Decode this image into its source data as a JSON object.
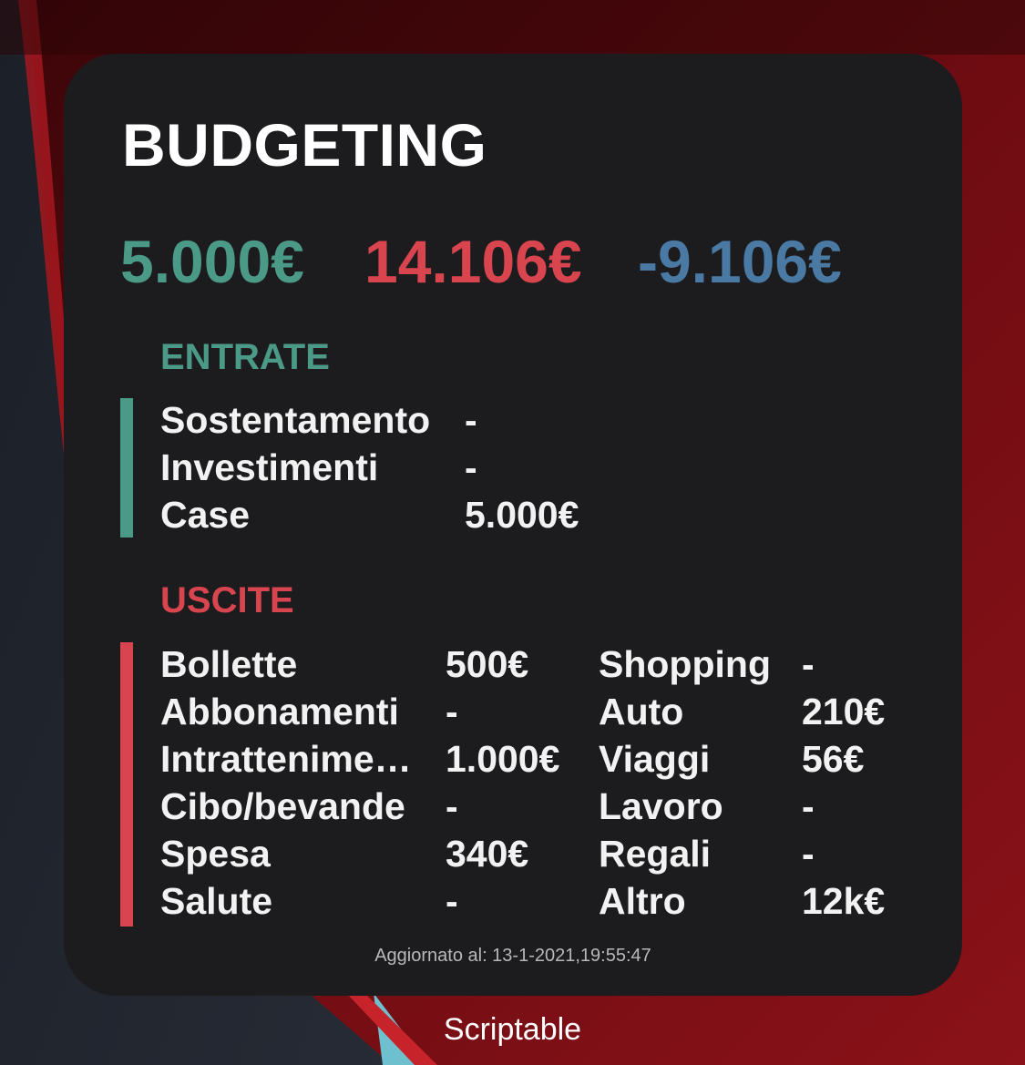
{
  "widget": {
    "title": "BUDGETING",
    "totals": {
      "income": "5.000€",
      "expenses": "14.106€",
      "balance": "-9.106€"
    },
    "colors": {
      "income": "#4b9a88",
      "expenses": "#d9454f",
      "balance": "#4a79a3",
      "background": "#1c1c1e"
    },
    "entrate": {
      "title": "ENTRATE",
      "rows": [
        {
          "label": "Sostentamento",
          "value": "-"
        },
        {
          "label": "Investimenti",
          "value": "-"
        },
        {
          "label": "Case",
          "value": "5.000€"
        }
      ]
    },
    "uscite": {
      "title": "USCITE",
      "left": [
        {
          "label": "Bollette",
          "value": "500€"
        },
        {
          "label": "Abbonamenti",
          "value": "-"
        },
        {
          "label": "Intrattenime…",
          "value": "1.000€"
        },
        {
          "label": "Cibo/bevande",
          "value": "-"
        },
        {
          "label": "Spesa",
          "value": "340€"
        },
        {
          "label": "Salute",
          "value": "-"
        }
      ],
      "right": [
        {
          "label": "Shopping",
          "value": "-"
        },
        {
          "label": "Auto",
          "value": "210€"
        },
        {
          "label": "Viaggi",
          "value": "56€"
        },
        {
          "label": "Lavoro",
          "value": "-"
        },
        {
          "label": "Regali",
          "value": "-"
        },
        {
          "label": "Altro",
          "value": "12k€"
        }
      ]
    },
    "updated": "Aggiornato al: 13-1-2021,19:55:47"
  },
  "app_label": "Scriptable"
}
